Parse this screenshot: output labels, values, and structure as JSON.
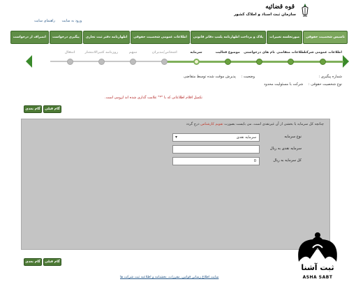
{
  "header": {
    "logo_line1": "قوه قضائیه",
    "logo_line2": "سازمان ثبت اسناد و املاک کشور",
    "links": [
      "ورود به سایت",
      "راهنمای سایت"
    ]
  },
  "nav": [
    {
      "label": "تاسیس شخصیت حقوقی",
      "active": true
    },
    {
      "label": "صورتجلسه تغییرات"
    },
    {
      "label": "پلاک و پرداخت اظهارنامه پلمپ دفاتر قانونی"
    },
    {
      "label": "اطلاعات عمومی شخصیت حقوقی"
    },
    {
      "label": "اظهارنامه دفتر ثبت تجاری"
    },
    {
      "label": "پیگیری درخواست"
    },
    {
      "label": "انصراف از درخواست"
    }
  ],
  "steps": [
    {
      "label": "اطلاعات عمومی شرکت",
      "state": "done"
    },
    {
      "label": "اطلاعات متقاضی",
      "state": "done"
    },
    {
      "label": "نام های درخواستی",
      "state": "done"
    },
    {
      "label": "موضوع فعالیت",
      "state": "done"
    },
    {
      "label": "سرمایه",
      "state": "current"
    },
    {
      "label": "اشخاص/مدیران",
      "state": "pending"
    },
    {
      "label": "سهم",
      "state": "pending"
    },
    {
      "label": "روزنامه کثیرالانتشار",
      "state": "pending"
    },
    {
      "label": "انتقال",
      "state": "pending"
    }
  ],
  "info": {
    "tracking_label": "شماره پیگیری :",
    "status_label": "وضعیت :",
    "status_value": "پذیرش موقت شده توسط متقاضی",
    "entity_type_label": "نوع شخصیت حقوقی :",
    "entity_type_value": "شرکت با مسئولیت محدود",
    "note": "تکمیل اقلام اطلاعاتی که با \"*\" علامت گذاری شده اند لزومی است."
  },
  "buttons": {
    "next": "گام بعدی",
    "prev": "گام قبلی"
  },
  "form": {
    "title_prefix": "چنانچه کل سرمایه یا بخشی از آن غیرنقدی است، می بایست بصورت ",
    "title_red": "تقویم کارشناس",
    "title_suffix": " درج گردد",
    "fields": [
      {
        "label": "نوع سرمایه",
        "value": "سرمایه نقدی",
        "type": "select"
      },
      {
        "label": "سرمایه نقدی به ریال",
        "value": "",
        "type": "text"
      },
      {
        "label": "کل سرمایه به ریال",
        "value": "0",
        "type": "text"
      }
    ]
  },
  "footer": {
    "link": "سایت اطلاع رسانی قوانین، مقررات، بخشنامه و اطلاعیه ثبت شرکت ها"
  },
  "watermark": {
    "title": "ثبت آشنا",
    "subtitle": "ASHA SABT"
  },
  "colors": {
    "nav_green": "#5f8d46",
    "button_green": "#4d7a35",
    "panel_gray": "#c4c4c4",
    "required_red": "#b22222"
  }
}
